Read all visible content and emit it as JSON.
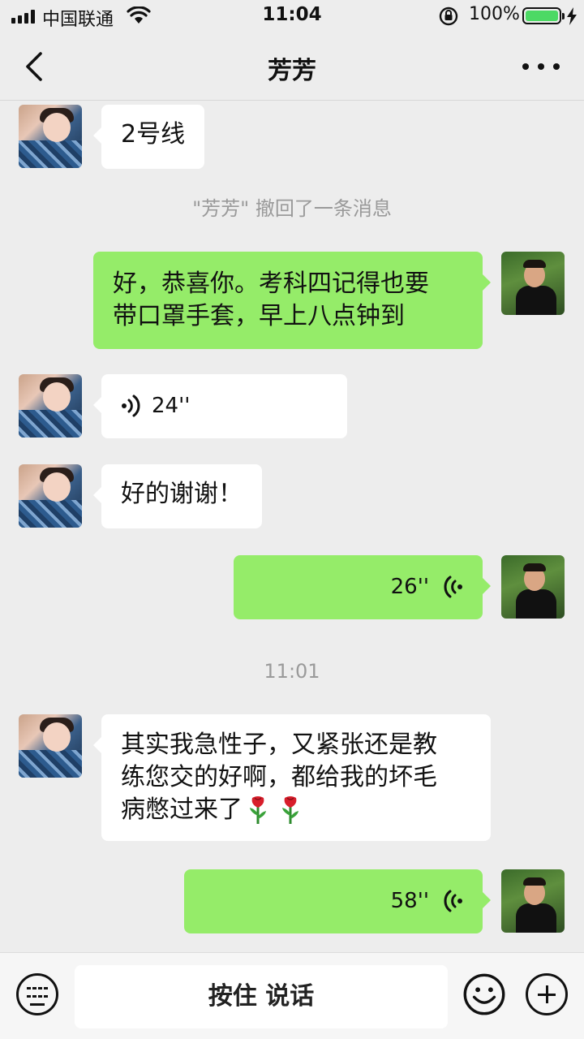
{
  "status_bar": {
    "carrier": "中国联通",
    "time": "11:04",
    "battery": "100%",
    "battery_level_percent": 100,
    "battery_color": "#4cd964",
    "icons": [
      "signal-icon",
      "wifi-icon",
      "orientation-lock-icon",
      "battery-icon",
      "charging-icon"
    ]
  },
  "nav": {
    "title": "芳芳",
    "back_icon": "chevron-left-icon",
    "more_icon": "more-dots-icon"
  },
  "messages": [
    {
      "type": "text",
      "direction": "in",
      "avatar": "contact-avatar",
      "text": "2号线"
    },
    {
      "type": "system",
      "text": "\"芳芳\" 撤回了一条消息"
    },
    {
      "type": "text",
      "direction": "out",
      "avatar": "self-avatar",
      "lines": [
        "好，恭喜你。考科四记得也要",
        "带口罩手套，早上八点钟到"
      ]
    },
    {
      "type": "voice",
      "direction": "in",
      "avatar": "contact-avatar",
      "duration": "24''"
    },
    {
      "type": "text",
      "direction": "in",
      "avatar": "contact-avatar",
      "text": "好的谢谢！"
    },
    {
      "type": "voice",
      "direction": "out",
      "avatar": "self-avatar",
      "duration": "26''"
    },
    {
      "type": "system",
      "text": "11:01"
    },
    {
      "type": "text",
      "direction": "in",
      "avatar": "contact-avatar",
      "lines": [
        "其实我急性子，又紧张还是教",
        "练您交的好啊，都给我的坏毛",
        "病憋过来了"
      ],
      "emoji": [
        "rose-icon",
        "rose-icon"
      ]
    },
    {
      "type": "voice",
      "direction": "out",
      "avatar": "self-avatar",
      "duration": "58''"
    }
  ],
  "input_bar": {
    "hold_to_talk": "按住 说话",
    "keyboard_icon": "keyboard-icon",
    "emoji_icon": "emoji-icon",
    "plus_icon": "plus-icon"
  },
  "colors": {
    "background": "#ededed",
    "incoming_bubble": "#ffffff",
    "outgoing_bubble": "#95ec69",
    "system_text": "#9a9a9a"
  }
}
